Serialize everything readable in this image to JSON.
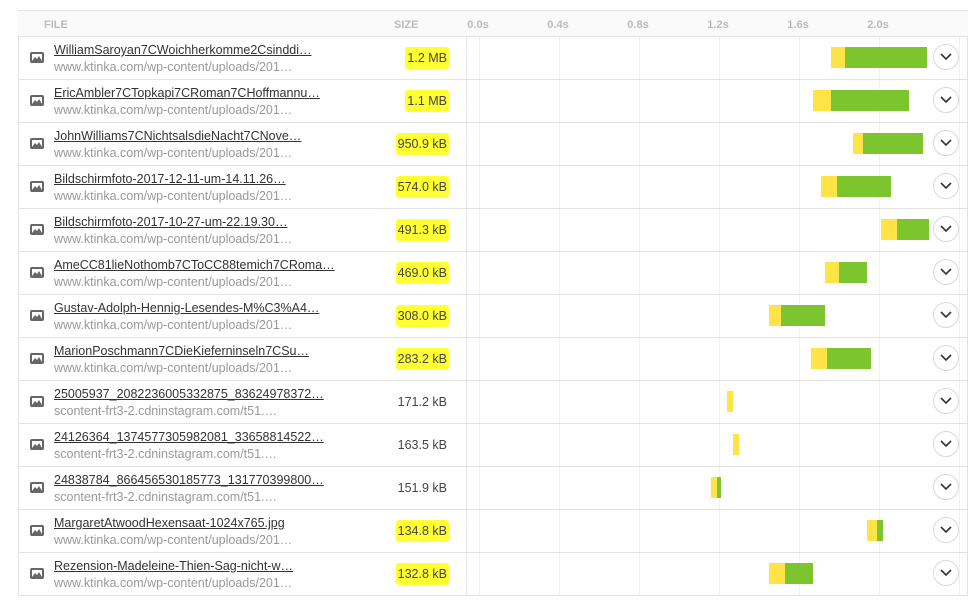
{
  "header": {
    "file_label": "FILE",
    "size_label": "SIZE",
    "ticks": [
      "0.0s",
      "0.4s",
      "0.8s",
      "1.2s",
      "1.6s",
      "2.0s"
    ]
  },
  "rows": [
    {
      "name": "WilliamSaroyan7CWoichherkomme2Csinddi…",
      "url": "www.ktinka.com/wp-content/uploads/201…",
      "size": "1.2 MB",
      "highlighted": true,
      "start": 1.76,
      "wait": 0.07,
      "end": 2.24
    },
    {
      "name": "EricAmbler7CTopkapi7CRoman7CHoffmannu…",
      "url": "www.ktinka.com/wp-content/uploads/201…",
      "size": "1.1 MB",
      "highlighted": true,
      "start": 1.67,
      "wait": 0.09,
      "end": 2.15
    },
    {
      "name": "JohnWilliams7CNichtsalsdieNacht7CNove…",
      "url": "www.ktinka.com/wp-content/uploads/201…",
      "size": "950.9 kB",
      "highlighted": true,
      "start": 1.87,
      "wait": 0.05,
      "end": 2.22
    },
    {
      "name": "Bildschirmfoto-2017-12-11-um-14.11.26…",
      "url": "www.ktinka.com/wp-content/uploads/201…",
      "size": "574.0 kB",
      "highlighted": true,
      "start": 1.71,
      "wait": 0.08,
      "end": 2.06
    },
    {
      "name": "Bildschirmfoto-2017-10-27-um-22.19.30…",
      "url": "www.ktinka.com/wp-content/uploads/201…",
      "size": "491.3 kB",
      "highlighted": true,
      "start": 2.01,
      "wait": 0.08,
      "end": 2.25
    },
    {
      "name": "AmeCC81lieNothomb7CToCC88temich7CRoma…",
      "url": "www.ktinka.com/wp-content/uploads/201…",
      "size": "469.0 kB",
      "highlighted": true,
      "start": 1.73,
      "wait": 0.07,
      "end": 1.94
    },
    {
      "name": "Gustav-Adolph-Hennig-Lesendes-M%C3%A4…",
      "url": "www.ktinka.com/wp-content/uploads/201…",
      "size": "308.0 kB",
      "highlighted": true,
      "start": 1.45,
      "wait": 0.06,
      "end": 1.73
    },
    {
      "name": "MarionPoschmann7CDieKieferninseln7CSu…",
      "url": "www.ktinka.com/wp-content/uploads/201…",
      "size": "283.2 kB",
      "highlighted": true,
      "start": 1.66,
      "wait": 0.08,
      "end": 1.96
    },
    {
      "name": "25005937_2082236005332875_83624978372…",
      "url": "scontent-frt3-2.cdninstagram.com/t51.…",
      "size": "171.2 kB",
      "highlighted": false,
      "start": 1.24,
      "wait": 0.03,
      "end": 1.27
    },
    {
      "name": "24126364_1374577305982081_33658814522…",
      "url": "scontent-frt3-2.cdninstagram.com/t51.…",
      "size": "163.5 kB",
      "highlighted": false,
      "start": 1.27,
      "wait": 0.03,
      "end": 1.3
    },
    {
      "name": "24838784_866456530185773_131770399800…",
      "url": "scontent-frt3-2.cdninstagram.com/t51.…",
      "size": "151.9 kB",
      "highlighted": false,
      "start": 1.16,
      "wait": 0.03,
      "end": 1.21
    },
    {
      "name": "MargaretAtwoodHexensaat-1024x765.jpg",
      "url": "www.ktinka.com/wp-content/uploads/201…",
      "size": "134.8 kB",
      "highlighted": true,
      "start": 1.94,
      "wait": 0.05,
      "end": 2.02
    },
    {
      "name": "Rezension-Madeleine-Thien-Sag-nicht-w…",
      "url": "www.ktinka.com/wp-content/uploads/201…",
      "size": "132.8 kB",
      "highlighted": true,
      "start": 1.45,
      "wait": 0.08,
      "end": 1.67
    }
  ],
  "colors": {
    "highlight": "#ffff33",
    "wait": "#ffe347",
    "receive": "#7dc52e"
  },
  "icons": {
    "row_icon": "image-icon",
    "expand_icon": "chevron-down-icon"
  }
}
